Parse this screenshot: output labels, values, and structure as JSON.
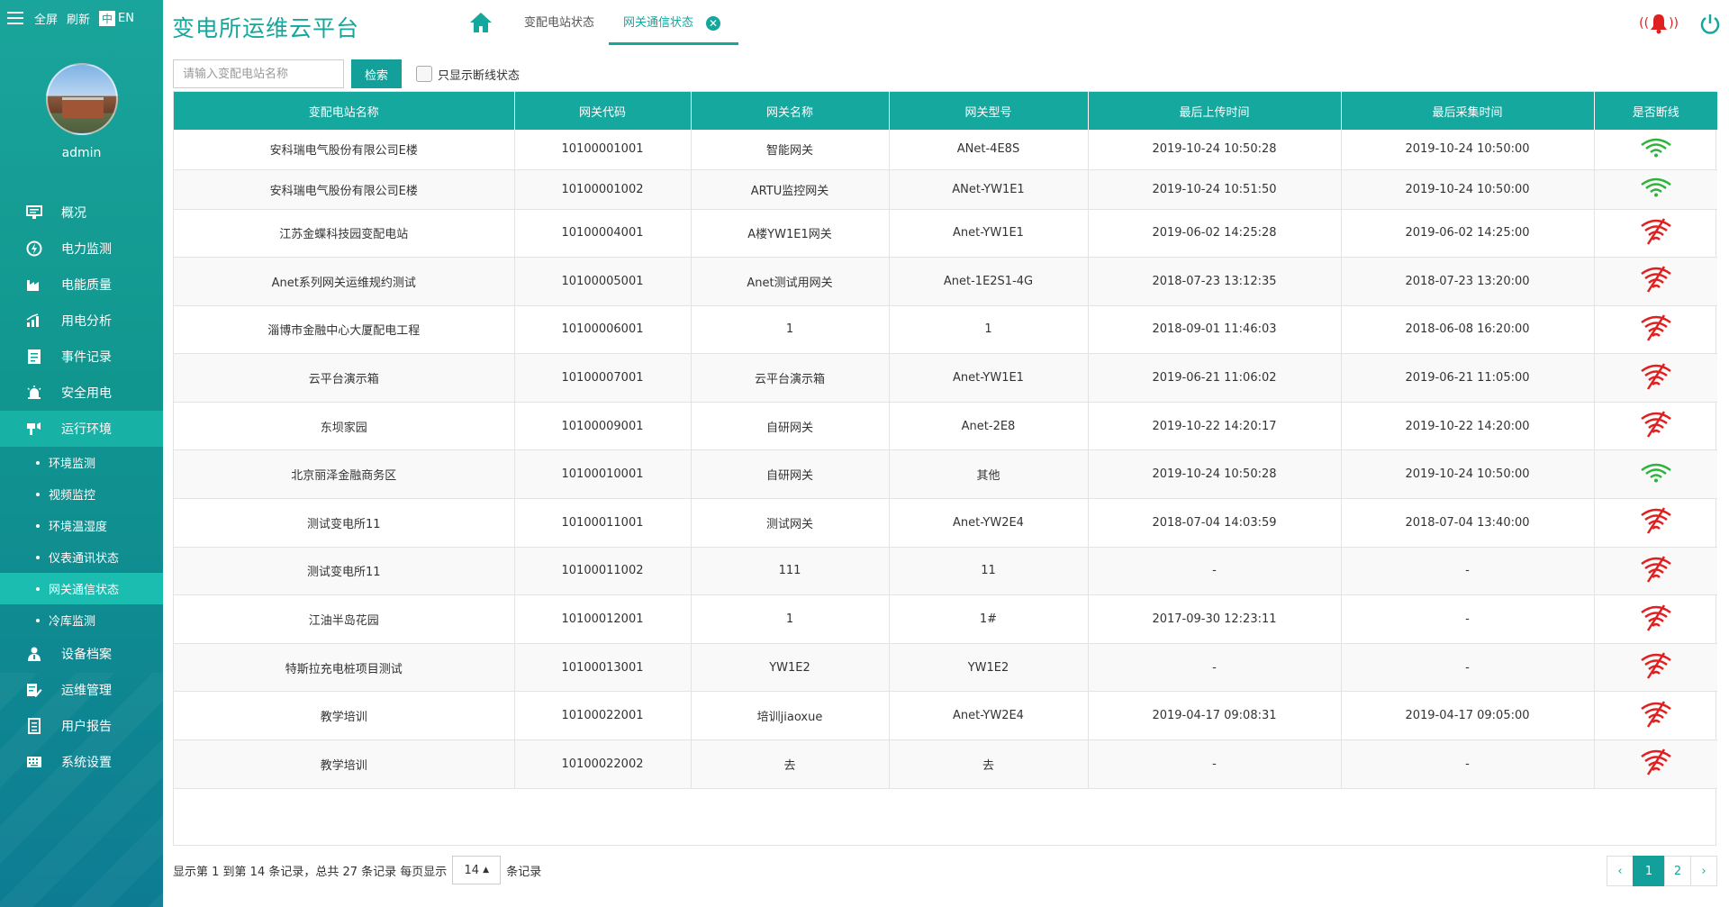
{
  "sidebar": {
    "topbar": {
      "fullscreen": "全屏",
      "refresh": "刷新",
      "lang_zh": "中",
      "lang_en": "EN"
    },
    "username": "admin",
    "items": [
      {
        "label": "概况",
        "icon": "monitor-icon"
      },
      {
        "label": "电力监测",
        "icon": "power-monitor-icon"
      },
      {
        "label": "电能质量",
        "icon": "factory-icon"
      },
      {
        "label": "用电分析",
        "icon": "bar-chart-icon"
      },
      {
        "label": "事件记录",
        "icon": "document-icon"
      },
      {
        "label": "安全用电",
        "icon": "alarm-light-icon"
      },
      {
        "label": "运行环境",
        "icon": "environment-icon"
      }
    ],
    "sub_items": [
      {
        "label": "环境监测"
      },
      {
        "label": "视频监控"
      },
      {
        "label": "环境温湿度"
      },
      {
        "label": "仪表通讯状态"
      },
      {
        "label": "网关通信状态"
      },
      {
        "label": "冷库监测"
      }
    ],
    "items_after": [
      {
        "label": "设备档案",
        "icon": "person-icon"
      },
      {
        "label": "运维管理",
        "icon": "edit-icon"
      },
      {
        "label": "用户报告",
        "icon": "report-icon"
      },
      {
        "label": "系统设置",
        "icon": "keyboard-icon"
      }
    ]
  },
  "header": {
    "title": "变电所运维云平台",
    "tabs": [
      {
        "label": "变配电站状态"
      },
      {
        "label": "网关通信状态"
      }
    ],
    "alarm_text": "((",
    "alarm_text_right": "))"
  },
  "search": {
    "placeholder": "请输入变配电站名称",
    "button": "检索",
    "checkbox_label": "只显示断线状态"
  },
  "table": {
    "headers": [
      "变配电站名称",
      "网关代码",
      "网关名称",
      "网关型号",
      "最后上传时间",
      "最后采集时间",
      "是否断线"
    ],
    "rows": [
      [
        "安科瑞电气股份有限公司E楼",
        "10100001001",
        "智能网关",
        "ANet-4E8S",
        "2019-10-24 10:50:28",
        "2019-10-24 10:50:00",
        "online"
      ],
      [
        "安科瑞电气股份有限公司E楼",
        "10100001002",
        "ARTU监控网关",
        "ANet-YW1E1",
        "2019-10-24 10:51:50",
        "2019-10-24 10:50:00",
        "online"
      ],
      [
        "江苏金蝶科技园变配电站",
        "10100004001",
        "A楼YW1E1网关",
        "Anet-YW1E1",
        "2019-06-02 14:25:28",
        "2019-06-02 14:25:00",
        "offline"
      ],
      [
        "Anet系列网关运维规约测试",
        "10100005001",
        "Anet测试用网关",
        "Anet-1E2S1-4G",
        "2018-07-23 13:12:35",
        "2018-07-23 13:20:00",
        "offline"
      ],
      [
        "淄博市金融中心大厦配电工程",
        "10100006001",
        "1",
        "1",
        "2018-09-01 11:46:03",
        "2018-06-08 16:20:00",
        "offline"
      ],
      [
        "云平台演示箱",
        "10100007001",
        "云平台演示箱",
        "Anet-YW1E1",
        "2019-06-21 11:06:02",
        "2019-06-21 11:05:00",
        "offline"
      ],
      [
        "东坝家园",
        "10100009001",
        "自研网关",
        "Anet-2E8",
        "2019-10-22 14:20:17",
        "2019-10-22 14:20:00",
        "offline"
      ],
      [
        "北京丽泽金融商务区",
        "10100010001",
        "自研网关",
        "其他",
        "2019-10-24 10:50:28",
        "2019-10-24 10:50:00",
        "online"
      ],
      [
        "测试变电所11",
        "10100011001",
        "测试网关",
        "Anet-YW2E4",
        "2018-07-04 14:03:59",
        "2018-07-04 13:40:00",
        "offline"
      ],
      [
        "测试变电所11",
        "10100011002",
        "111",
        "11",
        "-",
        "-",
        "offline"
      ],
      [
        "江油半岛花园",
        "10100012001",
        "1",
        "1#",
        "2017-09-30 12:23:11",
        "-",
        "offline"
      ],
      [
        "特斯拉充电桩项目测试",
        "10100013001",
        "YW1E2",
        "YW1E2",
        "-",
        "-",
        "offline"
      ],
      [
        "教学培训",
        "10100022001",
        "培训jiaoxue",
        "Anet-YW2E4",
        "2019-04-17 09:08:31",
        "2019-04-17 09:05:00",
        "offline"
      ],
      [
        "教学培训",
        "10100022002",
        "去",
        "去",
        "-",
        "-",
        "offline"
      ]
    ]
  },
  "footer": {
    "info_prefix": "显示第 1 到第 14 条记录，总共 27 条记录 每页显示",
    "page_size": "14",
    "info_suffix": "条记录",
    "pages": {
      "prev": "‹",
      "p1": "1",
      "p2": "2",
      "next": "›"
    }
  },
  "colors": {
    "accent": "#14a09a",
    "online": "#2fb33a",
    "offline": "#e02020"
  }
}
